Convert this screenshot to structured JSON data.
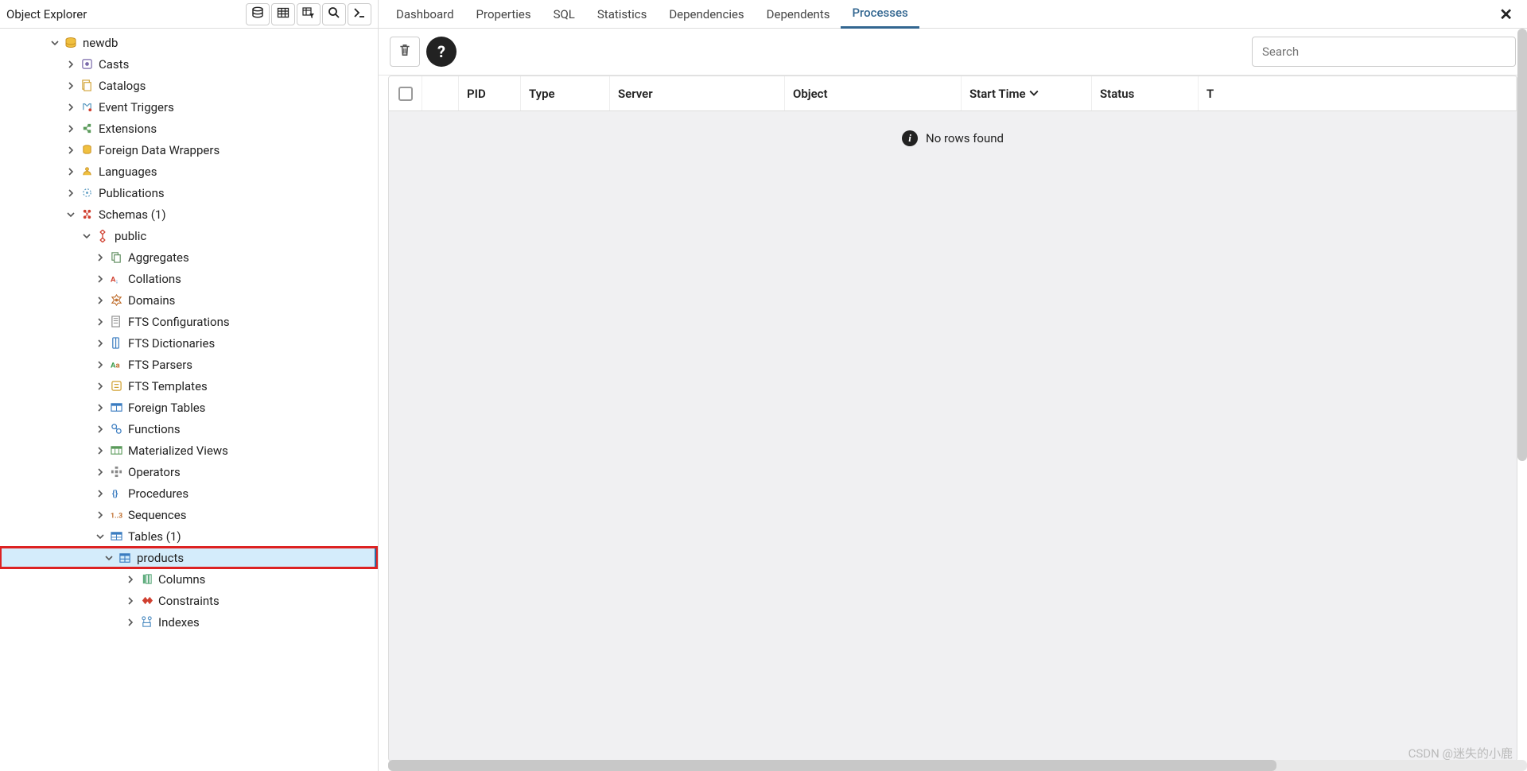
{
  "sidebar": {
    "title": "Object Explorer",
    "db": {
      "label": "newdb"
    },
    "items": [
      {
        "label": "Casts"
      },
      {
        "label": "Catalogs"
      },
      {
        "label": "Event Triggers"
      },
      {
        "label": "Extensions"
      },
      {
        "label": "Foreign Data Wrappers"
      },
      {
        "label": "Languages"
      },
      {
        "label": "Publications"
      },
      {
        "label": "Schemas (1)"
      }
    ],
    "schema": {
      "label": "public"
    },
    "schema_children": [
      {
        "label": "Aggregates"
      },
      {
        "label": "Collations"
      },
      {
        "label": "Domains"
      },
      {
        "label": "FTS Configurations"
      },
      {
        "label": "FTS Dictionaries"
      },
      {
        "label": "FTS Parsers"
      },
      {
        "label": "FTS Templates"
      },
      {
        "label": "Foreign Tables"
      },
      {
        "label": "Functions"
      },
      {
        "label": "Materialized Views"
      },
      {
        "label": "Operators"
      },
      {
        "label": "Procedures"
      },
      {
        "label": "Sequences"
      },
      {
        "label": "Tables (1)"
      }
    ],
    "table": {
      "label": "products"
    },
    "table_children": [
      {
        "label": "Columns"
      },
      {
        "label": "Constraints"
      },
      {
        "label": "Indexes"
      }
    ]
  },
  "tabs": [
    {
      "label": "Dashboard"
    },
    {
      "label": "Properties"
    },
    {
      "label": "SQL"
    },
    {
      "label": "Statistics"
    },
    {
      "label": "Dependencies"
    },
    {
      "label": "Dependents"
    },
    {
      "label": "Processes"
    }
  ],
  "toolbar": {
    "search_placeholder": "Search",
    "help": "?"
  },
  "grid": {
    "headers": {
      "pid": "PID",
      "type": "Type",
      "server": "Server",
      "object": "Object",
      "start": "Start Time",
      "status": "Status",
      "last": "T"
    },
    "empty": "No rows found"
  },
  "watermark": "CSDN @迷失的小鹿"
}
